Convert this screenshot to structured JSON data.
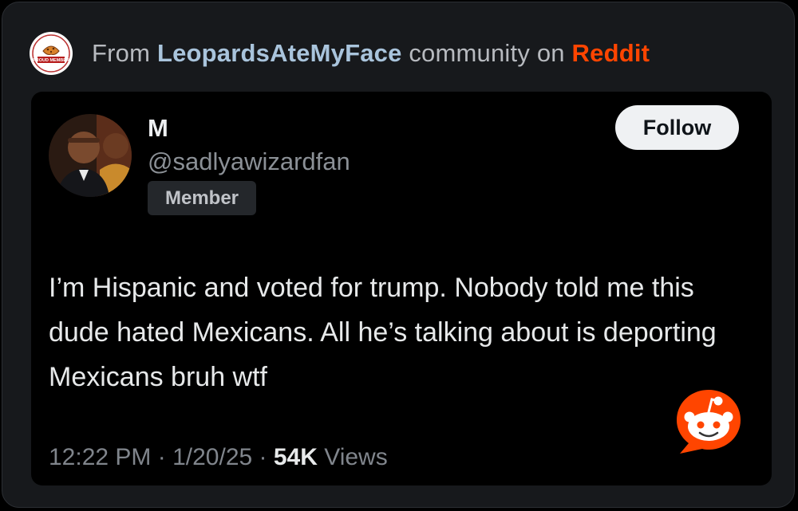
{
  "header": {
    "prefix": "From ",
    "community": "LeopardsAteMyFace",
    "middle": " community on ",
    "platform": "Reddit",
    "community_icon": "proud-member-badge",
    "community_icon_text": "PROUD MEMBER"
  },
  "post": {
    "display_name": "M",
    "handle": "@sadlyawizardfan",
    "badge": "Member",
    "follow_label": "Follow",
    "text": "I’m Hispanic and voted for trump. Nobody told me this dude hated Mexicans. All he’s talking about is deporting Mexicans bruh wtf",
    "time": "12:22 PM",
    "sep1": " · ",
    "date": "1/20/25",
    "sep2": " · ",
    "views_count": "54K",
    "views_label": " Views"
  },
  "icons": {
    "reddit": "reddit-snoo-icon"
  },
  "colors": {
    "accent": "#ff4500",
    "community": "#a9c4dc",
    "background": "#17191c"
  }
}
